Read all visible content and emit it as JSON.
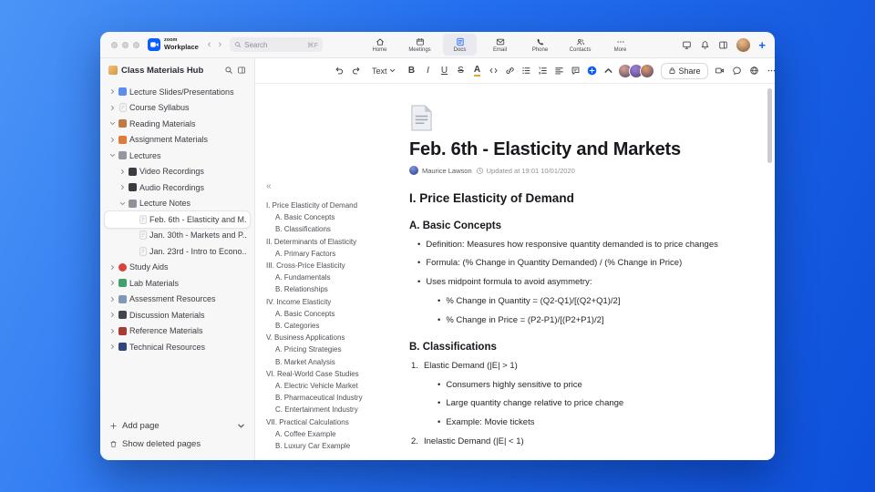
{
  "chrome": {
    "brand_top": "zoom",
    "brand_bottom": "Workplace",
    "search": {
      "placeholder": "Search",
      "shortcut": "⌘F"
    },
    "tabs": [
      {
        "label": "Home",
        "icon": "home"
      },
      {
        "label": "Meetings",
        "icon": "calendar"
      },
      {
        "label": "Docs",
        "icon": "doc",
        "active": true
      },
      {
        "label": "Email",
        "icon": "mail"
      },
      {
        "label": "Phone",
        "icon": "phone"
      },
      {
        "label": "Contacts",
        "icon": "contacts"
      },
      {
        "label": "More",
        "icon": "more"
      }
    ],
    "right_icons": [
      "screen-share",
      "bell",
      "panel"
    ]
  },
  "sidebar": {
    "title": "Class Materials Hub",
    "items": [
      {
        "label": "Lecture Slides/Presentations",
        "level": 0,
        "icon": "slides",
        "color": "#5b8def"
      },
      {
        "label": "Course Syllabus",
        "level": 0,
        "icon": "page"
      },
      {
        "label": "Reading Materials",
        "level": 0,
        "expanded": true,
        "icon": "book",
        "color": "#c07b42"
      },
      {
        "label": "Assignment Materials",
        "level": 0,
        "icon": "assignment",
        "color": "#e07b3a"
      },
      {
        "label": "Lectures",
        "level": 0,
        "expanded": true,
        "icon": "lectures",
        "color": "#9496a0"
      },
      {
        "label": "Video Recordings",
        "level": 1,
        "icon": "video-folder",
        "color": "#3b3c43"
      },
      {
        "label": "Audio Recordings",
        "level": 1,
        "icon": "audio",
        "color": "#3b3c43"
      },
      {
        "label": "Lecture Notes",
        "level": 1,
        "expanded": true,
        "icon": "notebook",
        "color": "#8e909a"
      },
      {
        "label": "Feb. 6th - Elasticity and M...",
        "level": 2,
        "icon": "page",
        "chevron": false,
        "selected": true
      },
      {
        "label": "Jan. 30th - Markets and P...",
        "level": 2,
        "icon": "page",
        "chevron": false
      },
      {
        "label": "Jan. 23rd - Intro to Econo...",
        "level": 2,
        "icon": "page",
        "chevron": false
      },
      {
        "label": "Study Aids",
        "level": 0,
        "icon": "apple",
        "color": "#d8433b",
        "round": true
      },
      {
        "label": "Lab Materials",
        "level": 0,
        "icon": "lab",
        "color": "#3ea26a"
      },
      {
        "label": "Assessment Resources",
        "level": 0,
        "icon": "assessment",
        "color": "#7f98b5"
      },
      {
        "label": "Discussion Materials",
        "level": 0,
        "icon": "discussion",
        "color": "#42454d"
      },
      {
        "label": "Reference Materials",
        "level": 0,
        "icon": "reference",
        "color": "#a83c35"
      },
      {
        "label": "Technical Resources",
        "level": 0,
        "icon": "technical",
        "color": "#31457f"
      }
    ],
    "footer": {
      "add_page": "Add page",
      "show_deleted": "Show deleted pages"
    }
  },
  "toolbar": {
    "text_style": "Text",
    "tools": [
      "undo",
      "redo",
      "text-style",
      "bold",
      "italic",
      "underline",
      "strikethrough",
      "text-color",
      "code",
      "link",
      "bulleted-list",
      "numbered-list",
      "align",
      "comment",
      "insert",
      "collapse"
    ],
    "collaborators": [
      {
        "color": "#d9a087"
      },
      {
        "color": "#9b7bd8"
      },
      {
        "color": "#e0995c"
      }
    ],
    "share_label": "Share",
    "right_icons": [
      "video",
      "chat",
      "globe",
      "more"
    ],
    "accent_color": "#0b5cff"
  },
  "outline": {
    "collapse": "«",
    "items": [
      {
        "label": "I. Price Elasticity of Demand",
        "level": 0
      },
      {
        "label": "A. Basic Concepts",
        "level": 1
      },
      {
        "label": "B. Classifications",
        "level": 1
      },
      {
        "label": "II. Determinants of Elasticity",
        "level": 0
      },
      {
        "label": "A. Primary Factors",
        "level": 1
      },
      {
        "label": "III. Cross-Price Elasticity",
        "level": 0
      },
      {
        "label": "A. Fundamentals",
        "level": 1
      },
      {
        "label": "B. Relationships",
        "level": 1
      },
      {
        "label": "IV. Income Elasticity",
        "level": 0
      },
      {
        "label": "A. Basic Concepts",
        "level": 1
      },
      {
        "label": "B. Categories",
        "level": 1
      },
      {
        "label": "V. Business Applications",
        "level": 0
      },
      {
        "label": "A. Pricing Strategies",
        "level": 1
      },
      {
        "label": "B. Market Analysis",
        "level": 1
      },
      {
        "label": "VI. Real-World Case Studies",
        "level": 0
      },
      {
        "label": "A. Electric Vehicle Market",
        "level": 1
      },
      {
        "label": "B. Pharmaceutical Industry",
        "level": 1
      },
      {
        "label": "C. Entertainment Industry",
        "level": 1
      },
      {
        "label": "VII. Practical Calculations",
        "level": 0
      },
      {
        "label": "A. Coffee Example",
        "level": 1
      },
      {
        "label": "B. Luxury Car Example",
        "level": 1
      }
    ]
  },
  "doc": {
    "title": "Feb. 6th - Elasticity and Markets",
    "author": "Maurice Lawson",
    "updated": "Updated at 19:01 10/01/2020",
    "blocks": [
      {
        "type": "h2",
        "text": "I. Price Elasticity of Demand"
      },
      {
        "type": "h3",
        "text": "A. Basic Concepts"
      },
      {
        "type": "bullet",
        "level": 1,
        "text": "Definition: Measures how responsive quantity demanded is to price changes"
      },
      {
        "type": "bullet",
        "level": 1,
        "text": "Formula: (% Change in Quantity Demanded) / (% Change in Price)"
      },
      {
        "type": "bullet",
        "level": 1,
        "text": "Uses midpoint formula to avoid asymmetry:"
      },
      {
        "type": "bullet",
        "level": 2,
        "text": "% Change in Quantity = (Q2-Q1)/[(Q2+Q1)/2]"
      },
      {
        "type": "bullet",
        "level": 2,
        "text": "% Change in Price = (P2-P1)/[(P2+P1)/2]"
      },
      {
        "type": "h3",
        "text": "B. Classifications"
      },
      {
        "type": "number",
        "num": "1.",
        "text": "Elastic Demand (|E| > 1)"
      },
      {
        "type": "bullet",
        "level": 2,
        "text": "Consumers highly sensitive to price"
      },
      {
        "type": "bullet",
        "level": 2,
        "text": "Large quantity change relative to price change"
      },
      {
        "type": "bullet",
        "level": 2,
        "text": "Example: Movie tickets"
      },
      {
        "type": "number",
        "num": "2.",
        "text": "Inelastic Demand (|E| < 1)"
      }
    ]
  }
}
